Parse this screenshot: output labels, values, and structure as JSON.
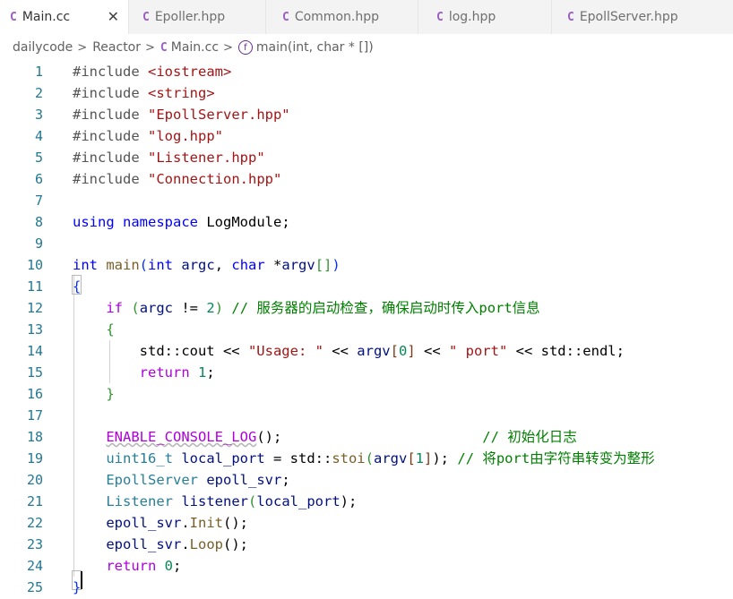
{
  "tabs": [
    {
      "icon": "C",
      "label": "Main.cc",
      "close": "✕"
    },
    {
      "icon": "C",
      "label": "Epoller.hpp"
    },
    {
      "icon": "C",
      "label": "Common.hpp"
    },
    {
      "icon": "C",
      "label": "log.hpp"
    },
    {
      "icon": "C",
      "label": "EpollServer.hpp"
    }
  ],
  "breadcrumb": {
    "folder": "dailycode",
    "subfolder": "Reactor",
    "file_icon": "C",
    "file": "Main.cc",
    "symbol_icon": "f",
    "symbol": "main(int, char * [])"
  },
  "line_numbers": [
    "1",
    "2",
    "3",
    "4",
    "5",
    "6",
    "7",
    "8",
    "9",
    "10",
    "11",
    "12",
    "13",
    "14",
    "15",
    "16",
    "17",
    "18",
    "19",
    "20",
    "21",
    "22",
    "23",
    "24",
    "25"
  ],
  "code": {
    "l1": [
      "#include",
      " ",
      "<iostream>"
    ],
    "l2": [
      "#include",
      " ",
      "<string>"
    ],
    "l3": [
      "#include",
      " ",
      "\"EpollServer.hpp\""
    ],
    "l4": [
      "#include",
      " ",
      "\"log.hpp\""
    ],
    "l5": [
      "#include",
      " ",
      "\"Listener.hpp\""
    ],
    "l6": [
      "#include",
      " ",
      "\"Connection.hpp\""
    ],
    "l8": [
      "using",
      " ",
      "namespace",
      " LogModule;"
    ],
    "l10": [
      "int",
      " ",
      "main",
      "(",
      "int",
      " ",
      "argc",
      ", ",
      "char",
      " *",
      "argv",
      "[]",
      ")"
    ],
    "l11": [
      "{"
    ],
    "l12": [
      "    ",
      "if",
      " ",
      "(",
      "argc",
      " != ",
      "2",
      ") ",
      "// 服务器的启动检查，确保启动时传入port信息"
    ],
    "l13": [
      "    ",
      "{"
    ],
    "l14": [
      "        std::cout << ",
      "\"Usage: \"",
      " << ",
      "argv",
      "[",
      "0",
      "]",
      " << ",
      "\" port\"",
      " << std::endl;"
    ],
    "l15": [
      "        ",
      "return",
      " ",
      "1",
      ";"
    ],
    "l16": [
      "    ",
      "}"
    ],
    "l18": [
      "    ",
      "ENABLE_CONSOLE_LOG",
      "();",
      "                        ",
      "// 初始化日志"
    ],
    "l19": [
      "    ",
      "uint16_t",
      " ",
      "local_port",
      " = std::",
      "stoi",
      "(",
      "argv",
      "[",
      "1",
      "]",
      ");",
      " ",
      "// 将port由字符串转变为整形"
    ],
    "l20": [
      "    ",
      "EpollServer",
      " ",
      "epoll_svr",
      ";"
    ],
    "l21": [
      "    ",
      "Listener",
      " ",
      "listener",
      "(",
      "local_port",
      ");"
    ],
    "l22": [
      "    ",
      "epoll_svr",
      ".",
      "Init",
      "();"
    ],
    "l23": [
      "    ",
      "epoll_svr",
      ".",
      "Loop",
      "();"
    ],
    "l24": [
      "    ",
      "return",
      " ",
      "0",
      ";"
    ],
    "l25": [
      "}"
    ]
  },
  "colors": {
    "keyword": "#0000ff",
    "control": "#af00db",
    "string": "#a31515",
    "comment": "#008000",
    "number": "#098658",
    "type": "#267f99",
    "function": "#795e26",
    "variable": "#001080",
    "line_number": "#237893"
  }
}
